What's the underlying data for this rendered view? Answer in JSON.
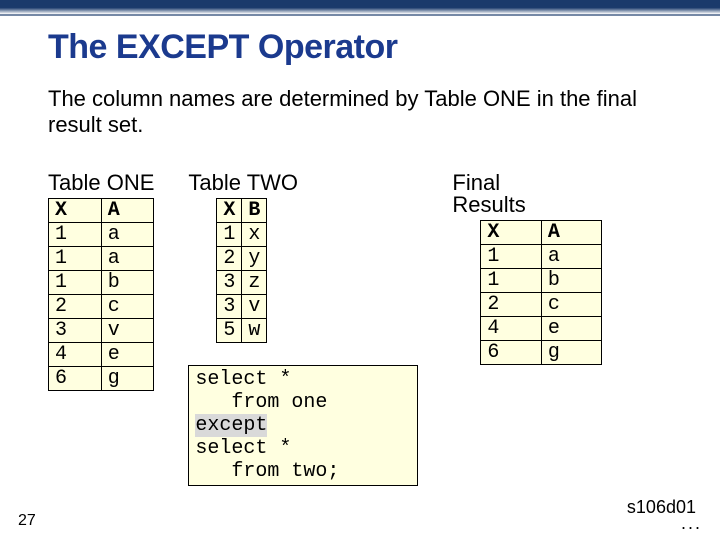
{
  "title": "The EXCEPT Operator",
  "subtitle": "The column names are determined by Table ONE in the final result set.",
  "slide_number": "27",
  "footer_code": "s106d01",
  "footer_dots": "...",
  "tables": {
    "one": {
      "title": "Table ONE",
      "head": {
        "c0": "X",
        "c1": "A"
      }
    },
    "two": {
      "title": "Table TWO",
      "head": {
        "c0": "X",
        "c1": "B"
      }
    },
    "final": {
      "title1": "Final",
      "title2": "Results",
      "head": {
        "c0": "X",
        "c1": "A"
      }
    }
  },
  "data_one": [
    {
      "x": "1",
      "a": "a"
    },
    {
      "x": "1",
      "a": "a"
    },
    {
      "x": "1",
      "a": "b"
    },
    {
      "x": "2",
      "a": "c"
    },
    {
      "x": "3",
      "a": "v"
    },
    {
      "x": "4",
      "a": "e"
    },
    {
      "x": "6",
      "a": "g"
    }
  ],
  "data_two": [
    {
      "x": "1",
      "b": "x"
    },
    {
      "x": "2",
      "b": "y"
    },
    {
      "x": "3",
      "b": "z"
    },
    {
      "x": "3",
      "b": "v"
    },
    {
      "x": "5",
      "b": "w"
    }
  ],
  "data_final": [
    {
      "x": "1",
      "a": "a"
    },
    {
      "x": "1",
      "a": "b"
    },
    {
      "x": "2",
      "a": "c"
    },
    {
      "x": "4",
      "a": "e"
    },
    {
      "x": "6",
      "a": "g"
    }
  ],
  "sql": {
    "l1": "select *",
    "l2": "   from one",
    "l3": "except",
    "l4": "select *",
    "l5": "   from two;"
  }
}
